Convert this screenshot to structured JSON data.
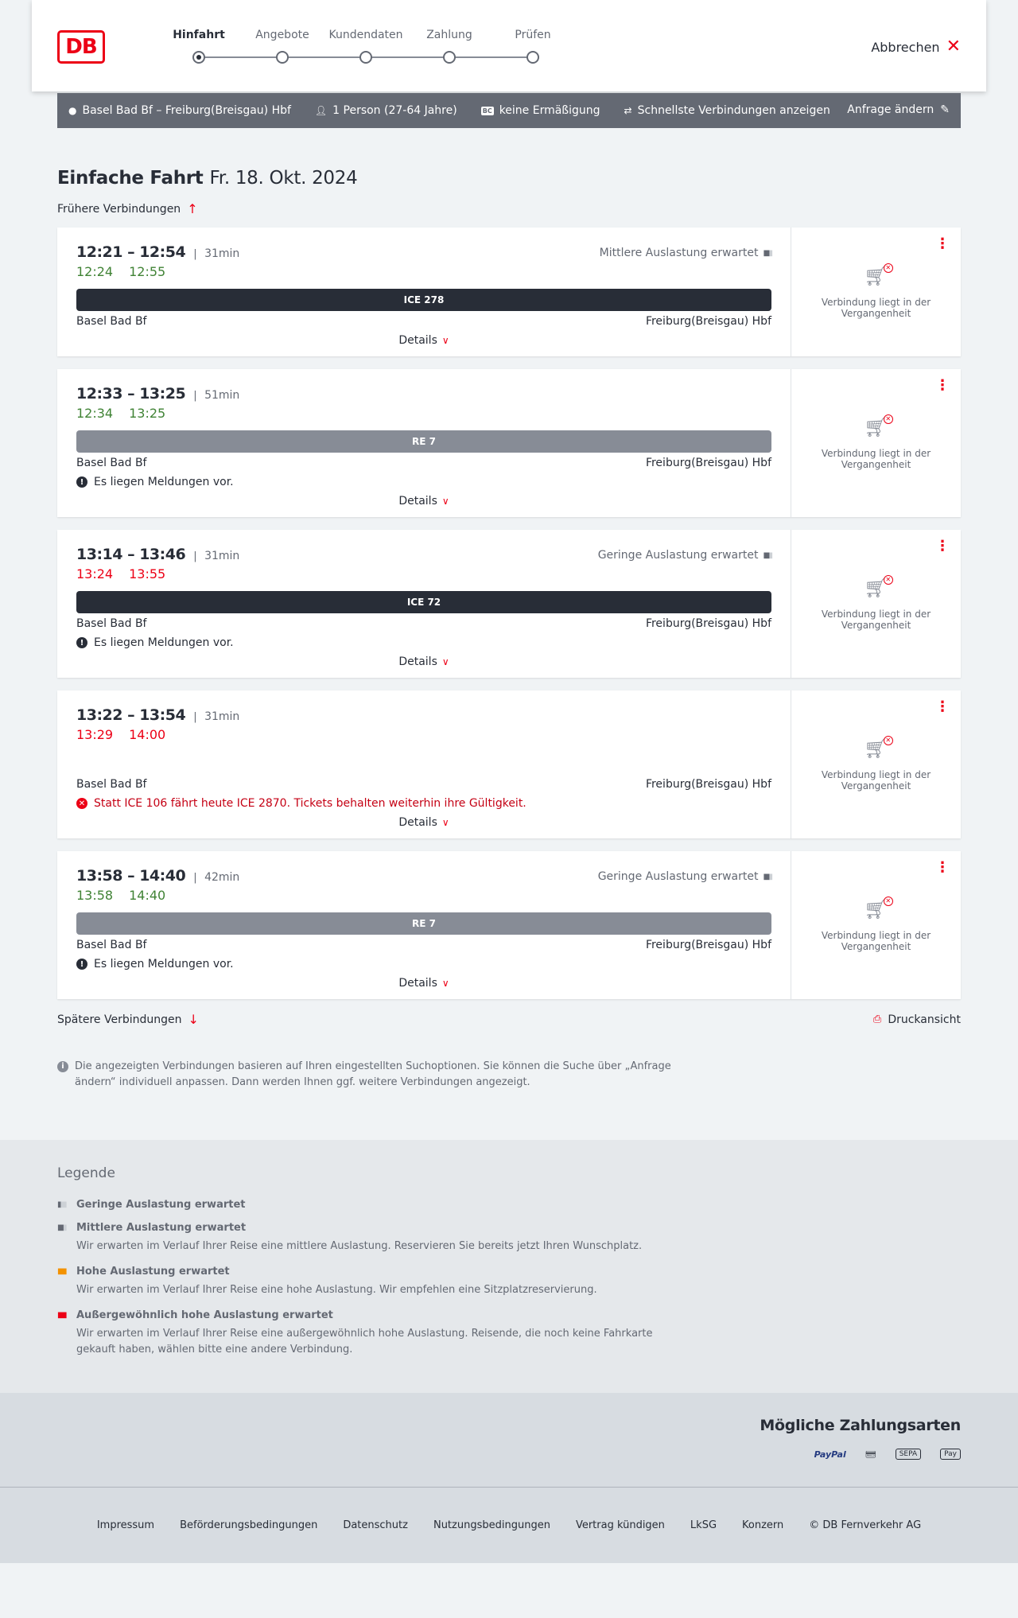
{
  "header": {
    "logo": "DB",
    "steps": [
      {
        "label": "Hinfahrt",
        "active": true
      },
      {
        "label": "Angebote",
        "active": false
      },
      {
        "label": "Kundendaten",
        "active": false
      },
      {
        "label": "Zahlung",
        "active": false
      },
      {
        "label": "Prüfen",
        "active": false
      }
    ],
    "cancel_label": "Abbrechen"
  },
  "summary": {
    "route": "Basel Bad Bf – Freiburg(Breisgau) Hbf",
    "travellers": "1 Person (27-64 Jahre)",
    "bahncard_badge": "BC",
    "discount": "keine Ermäßigung",
    "option": "Schnellste Verbindungen anzeigen",
    "edit_label": "Anfrage ändern"
  },
  "page": {
    "title": "Einfache Fahrt",
    "date": "Fr. 18. Okt. 2024",
    "earlier_label": "Frühere Verbindungen",
    "later_label": "Spätere Verbindungen",
    "print_label": "Druckansicht",
    "info_text": "Die angezeigten Verbindungen basieren auf Ihren eingestellten Suchoptionen. Sie können die Suche über „Anfrage ändern“ individuell anpassen. Dann werden Ihnen ggf. weitere Verbindungen angezeigt."
  },
  "connections": [
    {
      "planned": "12:21 – 12:54",
      "duration": "31min",
      "rt_dep": "12:24",
      "rt_arr": "12:55",
      "rt_state": "green",
      "load": "Mittlere Auslastung erwartet",
      "train": "ICE 278",
      "train_type": "ice",
      "from": "Basel Bad Bf",
      "to": "Freiburg(Breisgau) Hbf",
      "notice": "",
      "notice_type": "",
      "details": "Details",
      "status": "Verbindung liegt in der Vergangenheit"
    },
    {
      "planned": "12:33 – 13:25",
      "duration": "51min",
      "rt_dep": "12:34",
      "rt_arr": "13:25",
      "rt_state": "green",
      "load": "",
      "train": "RE 7",
      "train_type": "re",
      "from": "Basel Bad Bf",
      "to": "Freiburg(Breisgau) Hbf",
      "notice": "Es liegen Meldungen vor.",
      "notice_type": "info",
      "details": "Details",
      "status": "Verbindung liegt in der Vergangenheit"
    },
    {
      "planned": "13:14 – 13:46",
      "duration": "31min",
      "rt_dep": "13:24",
      "rt_arr": "13:55",
      "rt_state": "red",
      "load": "Geringe Auslastung erwartet",
      "train": "ICE 72",
      "train_type": "ice",
      "from": "Basel Bad Bf",
      "to": "Freiburg(Breisgau) Hbf",
      "notice": "Es liegen Meldungen vor.",
      "notice_type": "info",
      "details": "Details",
      "status": "Verbindung liegt in der Vergangenheit"
    },
    {
      "planned": "13:22 – 13:54",
      "duration": "31min",
      "rt_dep": "13:29",
      "rt_arr": "14:00",
      "rt_state": "red",
      "load": "",
      "train": "",
      "train_type": "none",
      "from": "Basel Bad Bf",
      "to": "Freiburg(Breisgau) Hbf",
      "notice": "Statt ICE 106 fährt heute ICE 2870. Tickets behalten weiterhin ihre Gültigkeit.",
      "notice_type": "err",
      "details": "Details",
      "status": "Verbindung liegt in der Vergangenheit"
    },
    {
      "planned": "13:58 – 14:40",
      "duration": "42min",
      "rt_dep": "13:58",
      "rt_arr": "14:40",
      "rt_state": "green",
      "load": "Geringe Auslastung erwartet",
      "train": "RE 7",
      "train_type": "re",
      "from": "Basel Bad Bf",
      "to": "Freiburg(Breisgau) Hbf",
      "notice": "Es liegen Meldungen vor.",
      "notice_type": "info",
      "details": "Details",
      "status": "Verbindung liegt in der Vergangenheit"
    }
  ],
  "legend": {
    "title": "Legende",
    "items": [
      {
        "label": "Geringe Auslastung erwartet",
        "desc": "",
        "color": "#646973"
      },
      {
        "label": "Mittlere Auslastung erwartet",
        "desc": "Wir erwarten im Verlauf Ihrer Reise eine mittlere Auslastung. Reservieren Sie bereits jetzt Ihren Wunschplatz.",
        "color": "#646973"
      },
      {
        "label": "Hohe Auslastung erwartet",
        "desc": "Wir erwarten im Verlauf Ihrer Reise eine hohe Auslastung. Wir empfehlen eine Sitzplatzreservierung.",
        "color": "#f39200"
      },
      {
        "label": "Außergewöhnlich hohe Auslastung erwartet",
        "desc": "Wir erwarten im Verlauf Ihrer Reise eine außergewöhnlich hohe Auslastung. Reisende, die noch keine Fahrkarte gekauft haben, wählen bitte eine andere Verbindung.",
        "color": "#ec0016"
      }
    ]
  },
  "payments": {
    "title": "Mögliche Zahlungsarten",
    "methods": [
      "PayPal",
      "credit-card-icon",
      "SEPA",
      "Pay"
    ]
  },
  "footer": {
    "links": [
      "Impressum",
      "Beförderungsbedingungen",
      "Datenschutz",
      "Nutzungsbedingungen",
      "Vertrag kündigen",
      "LkSG",
      "Konzern",
      "© DB Fernverkehr AG"
    ]
  },
  "colors": {
    "brand": "#ec0016",
    "on_time": "#408335",
    "delayed": "#ec0016",
    "summary_bar": "#646973"
  }
}
